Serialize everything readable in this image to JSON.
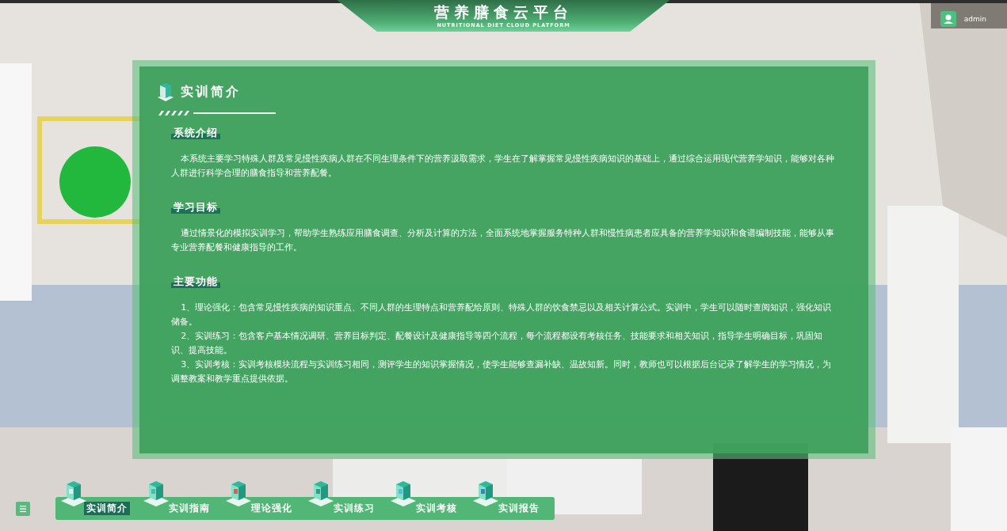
{
  "header": {
    "title": "营养膳食云平台",
    "subtitle": "NUTRITIONAL DIET CLOUD PLATFORM"
  },
  "user": {
    "name": "admin"
  },
  "panel": {
    "title": "实训简介",
    "sections": [
      {
        "heading": "系统介绍",
        "paragraphs": [
          "本系统主要学习特殊人群及常见慢性疾病人群在不同生理条件下的营养汲取需求，学生在了解掌握常见慢性疾病知识的基础上，通过综合运用现代营养学知识，能够对各种人群进行科学合理的膳食指导和营养配餐。"
        ]
      },
      {
        "heading": "学习目标",
        "paragraphs": [
          "通过情景化的模拟实训学习，帮助学生熟练应用膳食调查、分析及计算的方法，全面系统地掌握服务特种人群和慢性病患者应具备的营养学知识和食谱编制技能，能够从事专业营养配餐和健康指导的工作。"
        ]
      },
      {
        "heading": "主要功能",
        "paragraphs": [
          "1、理论强化：包含常见慢性疾病的知识重点、不同人群的生理特点和营养配给原则、特殊人群的饮食禁忌以及相关计算公式。实训中，学生可以随时查阅知识，强化知识储备。",
          "2、实训练习：包含客户基本情况调研、营养目标判定、配餐设计及健康指导等四个流程，每个流程都设有考核任务、技能要求和相关知识，指导学生明确目标，巩固知识、提高技能。",
          "3、实训考核：实训考核模块流程与实训练习相同，测评学生的知识掌握情况，使学生能够查漏补缺、温故知新。同时，教师也可以根据后台记录了解学生的学习情况，为调整教案和教学重点提供依据。"
        ]
      }
    ]
  },
  "nav": [
    {
      "label": "实训简介",
      "selected": true
    },
    {
      "label": "实训指南",
      "selected": false
    },
    {
      "label": "理论强化",
      "selected": false
    },
    {
      "label": "实训练习",
      "selected": false
    },
    {
      "label": "实训考核",
      "selected": false
    },
    {
      "label": "实训报告",
      "selected": false
    }
  ]
}
